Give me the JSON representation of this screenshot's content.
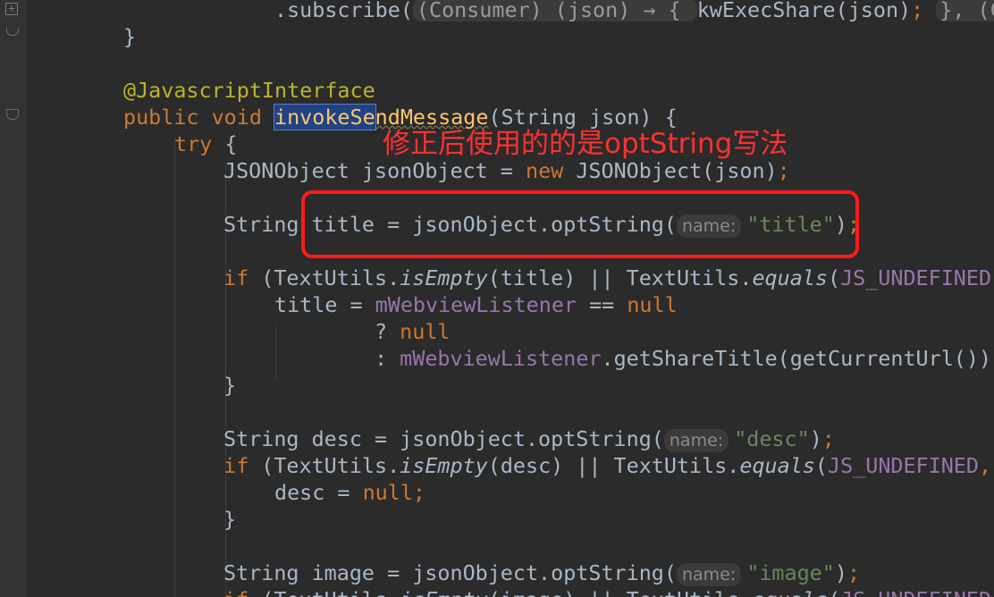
{
  "annotation": {
    "text": "修正后使用的的是optString写法",
    "color": "#ff1a1a"
  },
  "theme": {
    "background": "#2b2b2b",
    "keyword": "#cc7832",
    "field": "#9876aa",
    "string": "#6a8759",
    "annotation": "#bbb529",
    "method": "#ffc66d",
    "selection": "#214283"
  },
  "gutter_icons": [
    "fold-expand-icon",
    "fold-end-icon",
    "fold-collapse-icon"
  ],
  "lines": [
    {
      "segments": [
        {
          "t": ".subscribe(",
          "c": "plain"
        },
        {
          "t": "(Consumer) (json) → { ",
          "c": "hint-box"
        },
        {
          "t": "kwExecShare(json)",
          "c": "plain"
        },
        {
          "t": "; ",
          "c": "kw"
        },
        {
          "t": "}, (Co",
          "c": "hint-box"
        }
      ]
    },
    {
      "segments": [
        {
          "t": "}",
          "c": "plain"
        }
      ]
    },
    {
      "segments": []
    },
    {
      "segments": [
        {
          "t": "@JavascriptInterface",
          "c": "ann"
        }
      ]
    },
    {
      "segments": [
        {
          "t": "public void ",
          "c": "kw"
        },
        {
          "t": "invokeSe",
          "c": "sel"
        },
        {
          "t": "ndMessage",
          "c": "wavy"
        },
        {
          "t": "(String json) {",
          "c": "plain"
        }
      ]
    },
    {
      "segments": [
        {
          "t": "try ",
          "c": "kw"
        },
        {
          "t": "{",
          "c": "plain"
        }
      ]
    },
    {
      "segments": [
        {
          "t": "JSONObject jsonObject = ",
          "c": "plain"
        },
        {
          "t": "new ",
          "c": "kw"
        },
        {
          "t": "JSONObject(json)",
          "c": "plain"
        },
        {
          "t": ";",
          "c": "kw"
        }
      ]
    },
    {
      "segments": []
    },
    {
      "segments": [
        {
          "t": "String title = jsonObject.optString(",
          "c": "plain"
        },
        {
          "t": "name:",
          "c": "hint"
        },
        {
          "t": "\"title\"",
          "c": "str"
        },
        {
          "t": ")",
          "c": "plain"
        },
        {
          "t": ";",
          "c": "kw"
        }
      ]
    },
    {
      "segments": []
    },
    {
      "segments": [
        {
          "t": "if ",
          "c": "kw"
        },
        {
          "t": "(TextUtils.",
          "c": "plain"
        },
        {
          "t": "isEmpty",
          "c": "it"
        },
        {
          "t": "(title) || TextUtils.",
          "c": "plain"
        },
        {
          "t": "equals",
          "c": "it"
        },
        {
          "t": "(",
          "c": "plain"
        },
        {
          "t": "JS_UNDEFINED",
          "c": "field"
        },
        {
          "t": ",",
          "c": "kw"
        }
      ]
    },
    {
      "segments": [
        {
          "t": "title = ",
          "c": "plain"
        },
        {
          "t": "mWebviewListener ",
          "c": "field"
        },
        {
          "t": "== ",
          "c": "plain"
        },
        {
          "t": "null",
          "c": "kw"
        }
      ]
    },
    {
      "segments": [
        {
          "t": "? ",
          "c": "plain"
        },
        {
          "t": "null",
          "c": "kw"
        }
      ]
    },
    {
      "segments": [
        {
          "t": ": ",
          "c": "plain"
        },
        {
          "t": "mWebviewListener",
          "c": "field"
        },
        {
          "t": ".getShareTitle(getCurrentUrl())",
          "c": "plain"
        },
        {
          "t": ";",
          "c": "kw"
        }
      ]
    },
    {
      "segments": [
        {
          "t": "}",
          "c": "plain"
        }
      ]
    },
    {
      "segments": []
    },
    {
      "segments": [
        {
          "t": "String desc = jsonObject.optString(",
          "c": "plain"
        },
        {
          "t": "name:",
          "c": "hint"
        },
        {
          "t": "\"desc\"",
          "c": "str"
        },
        {
          "t": ")",
          "c": "plain"
        },
        {
          "t": ";",
          "c": "kw"
        }
      ]
    },
    {
      "segments": [
        {
          "t": "if ",
          "c": "kw"
        },
        {
          "t": "(TextUtils.",
          "c": "plain"
        },
        {
          "t": "isEmpty",
          "c": "it"
        },
        {
          "t": "(desc) || TextUtils.",
          "c": "plain"
        },
        {
          "t": "equals",
          "c": "it"
        },
        {
          "t": "(",
          "c": "plain"
        },
        {
          "t": "JS_UNDEFINED",
          "c": "field"
        },
        {
          "t": ",",
          "c": "kw"
        }
      ]
    },
    {
      "segments": [
        {
          "t": "desc = ",
          "c": "plain"
        },
        {
          "t": "null",
          "c": "kw"
        },
        {
          "t": ";",
          "c": "kw"
        }
      ]
    },
    {
      "segments": [
        {
          "t": "}",
          "c": "plain"
        }
      ]
    },
    {
      "segments": []
    },
    {
      "segments": [
        {
          "t": "String image = jsonObject.optString(",
          "c": "plain"
        },
        {
          "t": "name:",
          "c": "hint"
        },
        {
          "t": "\"image\"",
          "c": "str"
        },
        {
          "t": ")",
          "c": "plain"
        },
        {
          "t": ";",
          "c": "kw"
        }
      ]
    },
    {
      "segments": [
        {
          "t": "if ",
          "c": "kw"
        },
        {
          "t": "(TextUtils.",
          "c": "plain"
        },
        {
          "t": "isEmpty",
          "c": "it"
        },
        {
          "t": "(image) || TextUtils.",
          "c": "plain"
        },
        {
          "t": "equals",
          "c": "it"
        },
        {
          "t": "(",
          "c": "plain"
        },
        {
          "t": "JS_UNDEFINED",
          "c": "field"
        }
      ]
    }
  ]
}
